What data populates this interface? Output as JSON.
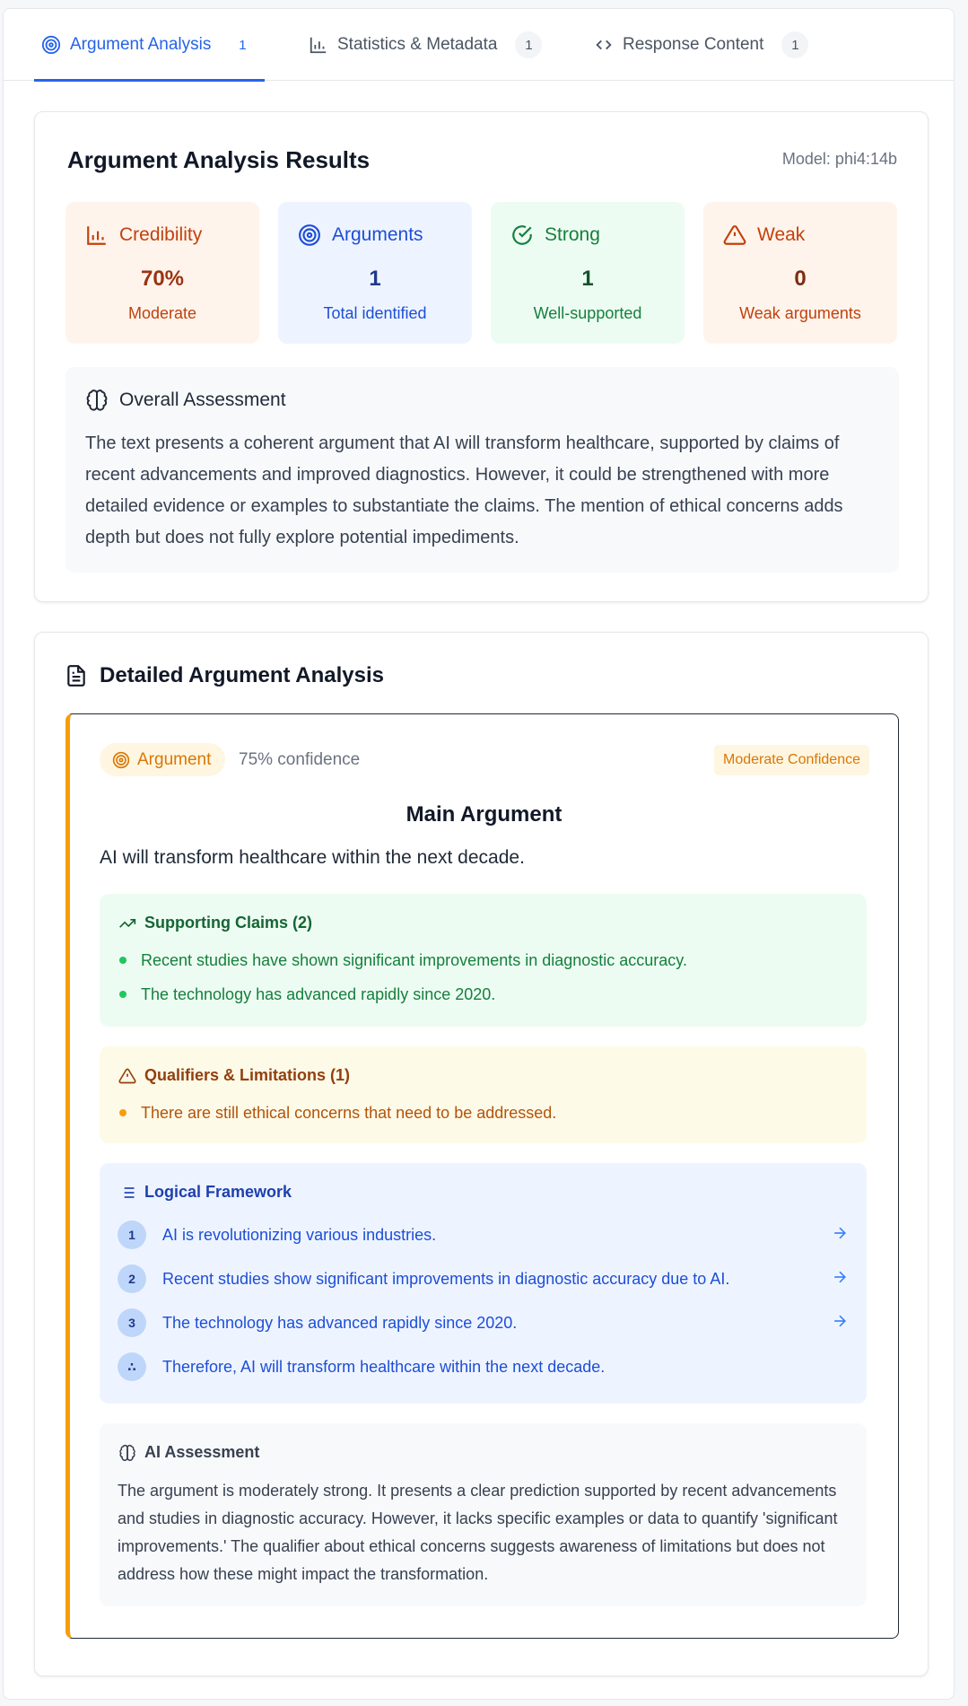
{
  "tabs": [
    {
      "label": "Argument Analysis",
      "count": "1",
      "icon": "target-icon",
      "active": true
    },
    {
      "label": "Statistics & Metadata",
      "count": "1",
      "icon": "bar-chart-icon",
      "active": false
    },
    {
      "label": "Response Content",
      "count": "1",
      "icon": "code-icon",
      "active": false
    }
  ],
  "results": {
    "title": "Argument Analysis Results",
    "model": "Model: phi4:14b",
    "stats": {
      "credibility": {
        "label": "Credibility",
        "value": "70%",
        "sub": "Moderate"
      },
      "arguments": {
        "label": "Arguments",
        "value": "1",
        "sub": "Total identified"
      },
      "strong": {
        "label": "Strong",
        "value": "1",
        "sub": "Well-supported"
      },
      "weak": {
        "label": "Weak",
        "value": "0",
        "sub": "Weak arguments"
      }
    },
    "overall": {
      "title": "Overall Assessment",
      "text": "The text presents a coherent argument that AI will transform healthcare, supported by claims of recent advancements and improved diagnostics. However, it could be strengthened with more detailed evidence or examples to substantiate the claims. The mention of ethical concerns adds depth but does not fully explore potential impediments."
    }
  },
  "detail": {
    "title": "Detailed Argument Analysis",
    "argument": {
      "badge": "Argument",
      "confidence": "75% confidence",
      "confidence_level": "Moderate Confidence",
      "main_title": "Main Argument",
      "main_text": "AI will transform healthcare within the next decade.",
      "supporting": {
        "title": "Supporting Claims (2)",
        "items": [
          "Recent studies have shown significant improvements in diagnostic accuracy.",
          "The technology has advanced rapidly since 2020."
        ]
      },
      "qualifiers": {
        "title": "Qualifiers & Limitations (1)",
        "items": [
          "There are still ethical concerns that need to be addressed."
        ]
      },
      "logic": {
        "title": "Logical Framework",
        "steps": [
          {
            "num": "1",
            "text": "AI is revolutionizing various industries."
          },
          {
            "num": "2",
            "text": "Recent studies show significant improvements in diagnostic accuracy due to AI."
          },
          {
            "num": "3",
            "text": "The technology has advanced rapidly since 2020."
          },
          {
            "num": "∴",
            "text": "Therefore, AI will transform healthcare within the next decade."
          }
        ]
      },
      "ai_assessment": {
        "title": "AI Assessment",
        "text": "The argument is moderately strong. It presents a clear prediction supported by recent advancements and studies in diagnostic accuracy. However, it lacks specific examples or data to quantify 'significant improvements.' The qualifier about ethical concerns suggests awareness of limitations but does not address how these might impact the transformation."
      }
    }
  }
}
